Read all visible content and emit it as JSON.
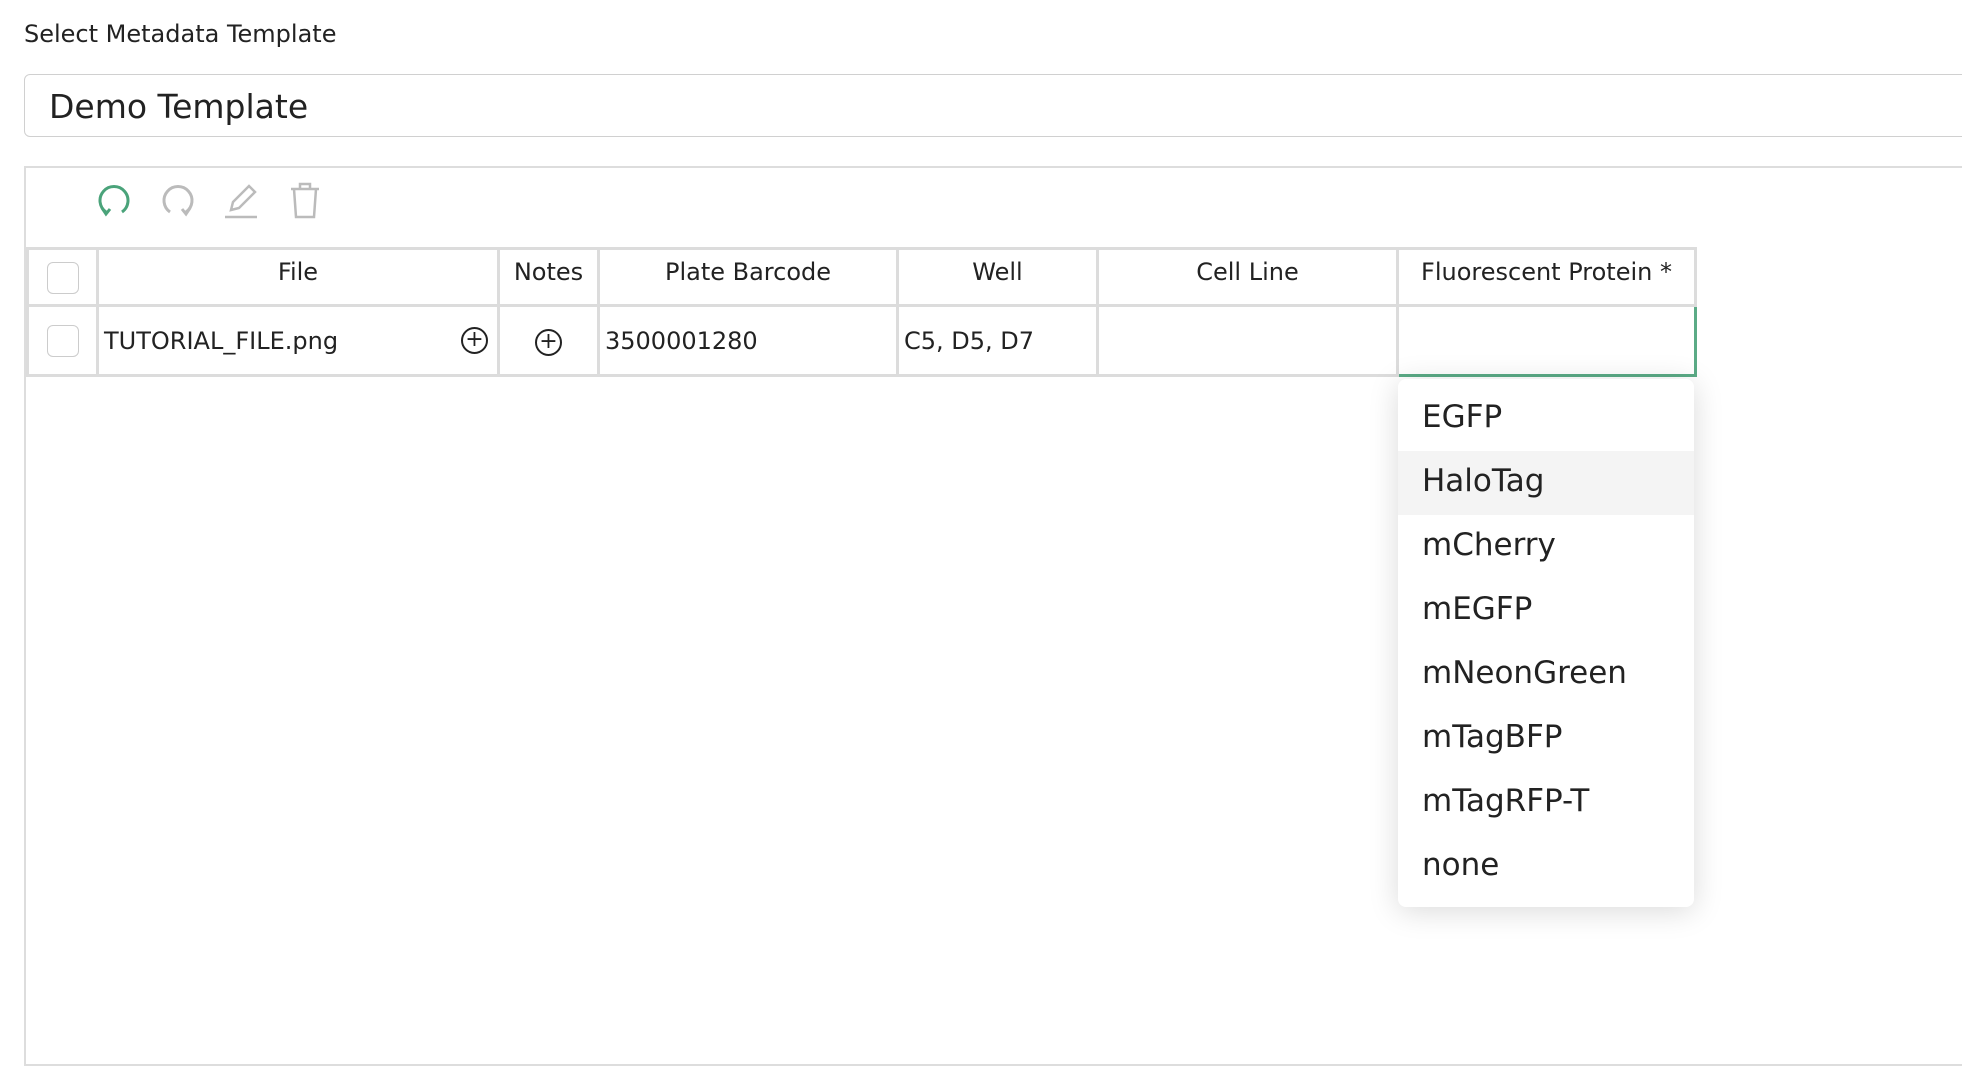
{
  "label": "Select Metadata Template",
  "template": "Demo Template",
  "toolbar": {
    "icons": [
      "undo-icon",
      "redo-icon",
      "edit-icon",
      "trash-icon"
    ],
    "accent": "#4aa37a"
  },
  "table": {
    "headers": [
      "File",
      "Notes",
      "Plate Barcode",
      "Well",
      "Cell Line",
      "Fluorescent Protein *"
    ],
    "rows": [
      {
        "file": "TUTORIAL_FILE.png",
        "notes": "",
        "plate_barcode": "3500001280",
        "well": "C5, D5, D7",
        "cell_line": "",
        "fluorescent_protein": ""
      }
    ]
  },
  "dropdown": {
    "options": [
      "EGFP",
      "HaloTag",
      "mCherry",
      "mEGFP",
      "mNeonGreen",
      "mTagBFP",
      "mTagRFP-T",
      "none"
    ],
    "highlighted": "HaloTag"
  }
}
